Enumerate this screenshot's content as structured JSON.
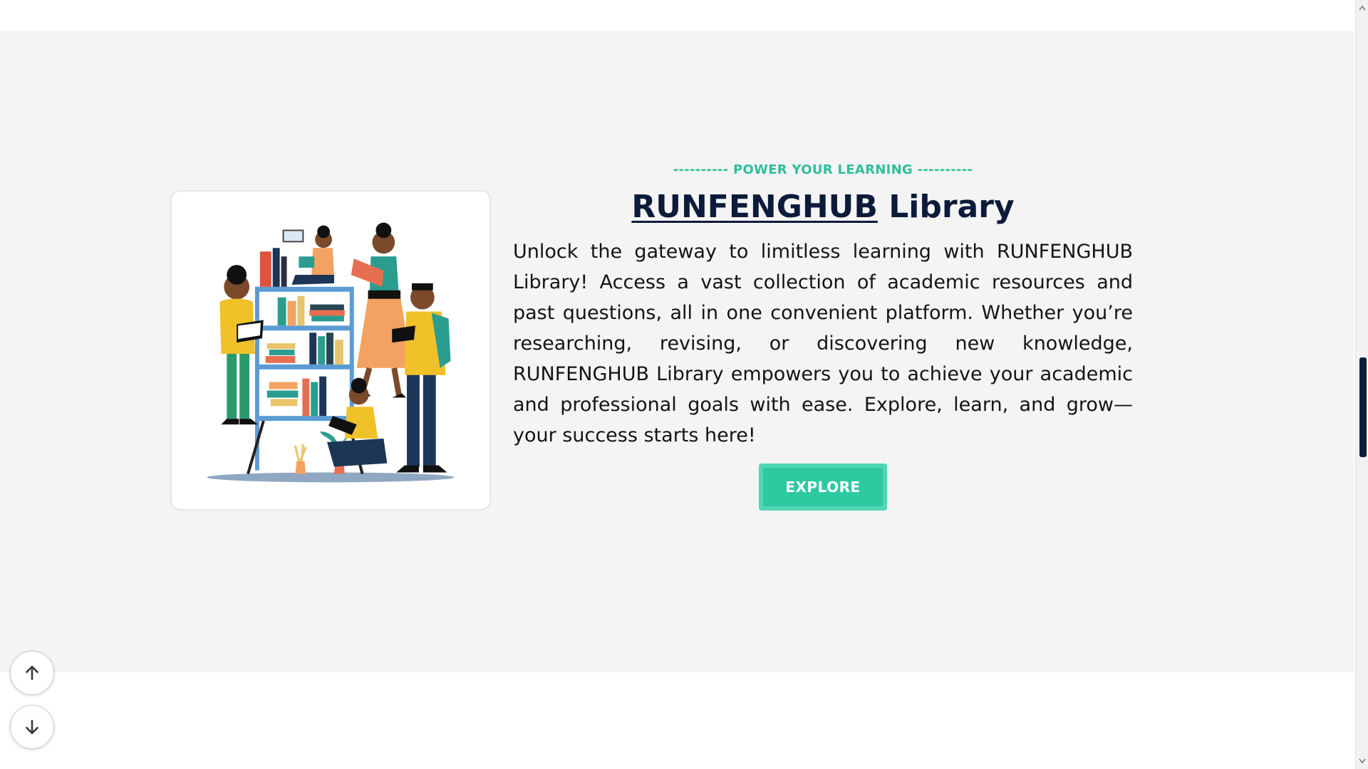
{
  "section": {
    "eyebrow": "---------- POWER YOUR LEARNING ----------",
    "title_brand": "RUNFENGHUB",
    "title_rest": " Library",
    "description": "Unlock the gateway to limitless learning with RUNFENGHUB Library! Access a vast collection of academic resources and past questions, all in one convenient platform. Whether you’re researching, revising, or discovering new knowledge, RUNFENGHUB Library empowers you to achieve your academic and professional goals with ease. Explore, learn, and grow—your success starts here!",
    "button_label": "EXPLORE",
    "image_icon": "library-readers-illustration"
  },
  "floating_nav": {
    "up_icon": "arrow-up-icon",
    "down_icon": "arrow-down-icon"
  },
  "colors": {
    "accent": "#2fbf9a",
    "button": "#2ec9a1",
    "heading": "#0d1b3a",
    "section_bg": "#f4f4f4"
  }
}
